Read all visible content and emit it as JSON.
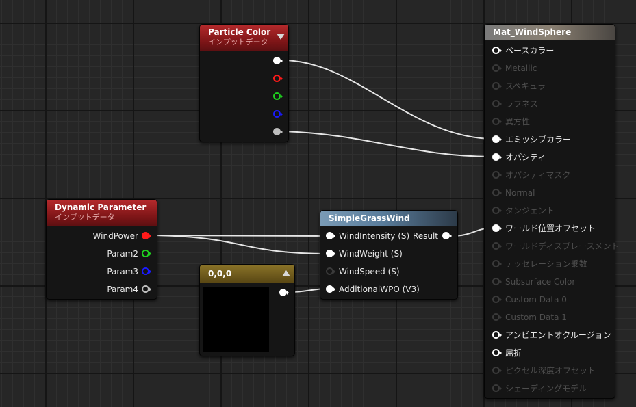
{
  "colors": {
    "white": "#ffffff",
    "red": "#ff1a1a",
    "green": "#1fd21f",
    "blue": "#1a1aff",
    "gray": "#bdbdbd",
    "wire": "#e6e6e6"
  },
  "particle_color": {
    "title": "Particle Color",
    "subtitle": "インプットデータ",
    "outputs": [
      {
        "pin": "white",
        "filled": true
      },
      {
        "pin": "red",
        "filled": false
      },
      {
        "pin": "green",
        "filled": false
      },
      {
        "pin": "blue",
        "filled": false
      },
      {
        "pin": "gray",
        "filled": true
      }
    ]
  },
  "dynamic_parameter": {
    "title": "Dynamic Parameter",
    "subtitle": "インプットデータ",
    "outputs": [
      "WindPower",
      "Param2",
      "Param3",
      "Param4"
    ]
  },
  "constant_node": {
    "title": "0,0,0"
  },
  "simple_grass_wind": {
    "title": "SimpleGrassWind",
    "inputs": [
      "WindIntensity (S)",
      "WindWeight (S)",
      "WindSpeed (S)",
      "AdditionalWPO (V3)"
    ],
    "output": "Result"
  },
  "material": {
    "title": "Mat_WindSphere",
    "inputs": [
      {
        "label": "ベースカラー",
        "active": true,
        "connected": false
      },
      {
        "label": "Metallic",
        "active": false,
        "connected": false
      },
      {
        "label": "スペキュラ",
        "active": false,
        "connected": false
      },
      {
        "label": "ラフネス",
        "active": false,
        "connected": false
      },
      {
        "label": "異方性",
        "active": false,
        "connected": false
      },
      {
        "label": "エミッシブカラー",
        "active": true,
        "connected": true
      },
      {
        "label": "オパシティ",
        "active": true,
        "connected": true
      },
      {
        "label": "オパシティマスク",
        "active": false,
        "connected": false
      },
      {
        "label": "Normal",
        "active": false,
        "connected": false
      },
      {
        "label": "タンジェント",
        "active": false,
        "connected": false
      },
      {
        "label": "ワールド位置オフセット",
        "active": true,
        "connected": true
      },
      {
        "label": "ワールドディスプレースメント",
        "active": false,
        "connected": false
      },
      {
        "label": "テッセレーション乗数",
        "active": false,
        "connected": false
      },
      {
        "label": "Subsurface Color",
        "active": false,
        "connected": false
      },
      {
        "label": "Custom Data 0",
        "active": false,
        "connected": false
      },
      {
        "label": "Custom Data 1",
        "active": false,
        "connected": false
      },
      {
        "label": "アンビエントオクルージョン",
        "active": true,
        "connected": false
      },
      {
        "label": "屈折",
        "active": true,
        "connected": false
      },
      {
        "label": "ピクセル深度オフセット",
        "active": false,
        "connected": false
      },
      {
        "label": "シェーディングモデル",
        "active": false,
        "connected": false
      }
    ]
  }
}
